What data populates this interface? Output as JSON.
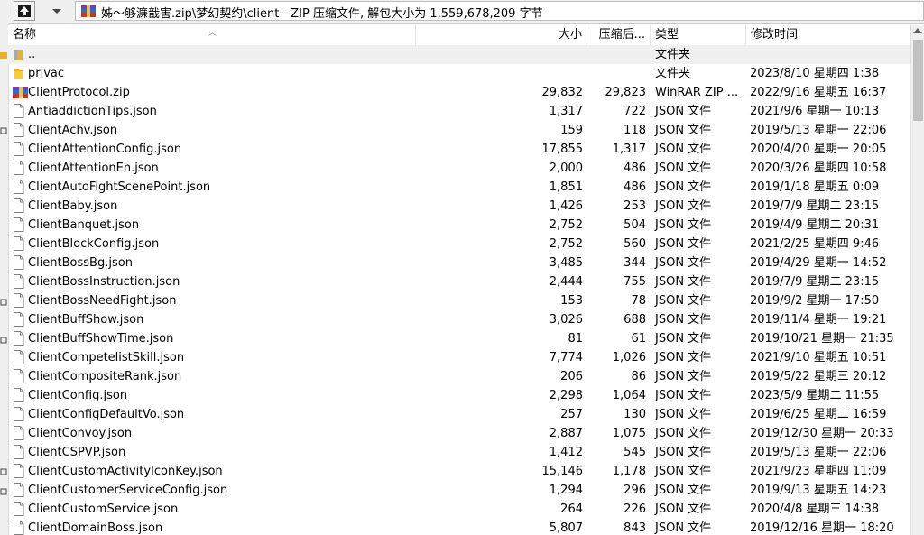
{
  "path_bar": {
    "path": "姊〜够濂戠害.zip\\梦幻契约\\client - ZIP 压缩文件, 解包大小为 1,559,678,209 字节"
  },
  "columns": {
    "name": "名称",
    "size": "大小",
    "packed": "压缩后...",
    "type": "类型",
    "modified": "修改时间"
  },
  "rows": [
    {
      "icon": "parent-folder-icon",
      "name": "..",
      "size": "",
      "packed": "",
      "type": "文件夹",
      "modified": ""
    },
    {
      "icon": "folder-icon",
      "name": "privac",
      "size": "",
      "packed": "",
      "type": "文件夹",
      "modified": "2023/8/10 星期四 1:38"
    },
    {
      "icon": "zip-archive-icon",
      "name": "ClientProtocol.zip",
      "size": "29,832",
      "packed": "29,823",
      "type": "WinRAR ZIP ...",
      "modified": "2022/9/16 星期五 16:37"
    },
    {
      "icon": "file-icon",
      "name": "AntiaddictionTips.json",
      "size": "1,317",
      "packed": "722",
      "type": "JSON 文件",
      "modified": "2021/9/6 星期一 10:13"
    },
    {
      "icon": "file-icon",
      "name": "ClientAchv.json",
      "size": "159",
      "packed": "118",
      "type": "JSON 文件",
      "modified": "2019/5/13 星期一 22:06"
    },
    {
      "icon": "file-icon",
      "name": "ClientAttentionConfig.json",
      "size": "17,855",
      "packed": "1,317",
      "type": "JSON 文件",
      "modified": "2020/4/20 星期一 20:05"
    },
    {
      "icon": "file-icon",
      "name": "ClientAttentionEn.json",
      "size": "2,000",
      "packed": "486",
      "type": "JSON 文件",
      "modified": "2020/3/26 星期四 10:58"
    },
    {
      "icon": "file-icon",
      "name": "ClientAutoFightScenePoint.json",
      "size": "1,851",
      "packed": "486",
      "type": "JSON 文件",
      "modified": "2019/1/18 星期五 0:09"
    },
    {
      "icon": "file-icon",
      "name": "ClientBaby.json",
      "size": "1,426",
      "packed": "253",
      "type": "JSON 文件",
      "modified": "2019/7/9 星期二 23:15"
    },
    {
      "icon": "file-icon",
      "name": "ClientBanquet.json",
      "size": "2,752",
      "packed": "504",
      "type": "JSON 文件",
      "modified": "2019/4/9 星期二 20:31"
    },
    {
      "icon": "file-icon",
      "name": "ClientBlockConfig.json",
      "size": "2,752",
      "packed": "560",
      "type": "JSON 文件",
      "modified": "2021/2/25 星期四 9:46"
    },
    {
      "icon": "file-icon",
      "name": "ClientBossBg.json",
      "size": "3,485",
      "packed": "344",
      "type": "JSON 文件",
      "modified": "2019/4/29 星期一 14:52"
    },
    {
      "icon": "file-icon",
      "name": "ClientBossInstruction.json",
      "size": "2,444",
      "packed": "755",
      "type": "JSON 文件",
      "modified": "2019/7/9 星期二 23:15"
    },
    {
      "icon": "file-icon",
      "name": "ClientBossNeedFight.json",
      "size": "153",
      "packed": "78",
      "type": "JSON 文件",
      "modified": "2019/9/2 星期一 17:50"
    },
    {
      "icon": "file-icon",
      "name": "ClientBuffShow.json",
      "size": "3,026",
      "packed": "688",
      "type": "JSON 文件",
      "modified": "2019/11/4 星期一 19:21"
    },
    {
      "icon": "file-icon",
      "name": "ClientBuffShowTime.json",
      "size": "81",
      "packed": "61",
      "type": "JSON 文件",
      "modified": "2019/10/21 星期一 21:35"
    },
    {
      "icon": "file-icon",
      "name": "ClientCompetelistSkill.json",
      "size": "7,774",
      "packed": "1,026",
      "type": "JSON 文件",
      "modified": "2021/9/10 星期五 10:51"
    },
    {
      "icon": "file-icon",
      "name": "ClientCompositeRank.json",
      "size": "206",
      "packed": "86",
      "type": "JSON 文件",
      "modified": "2019/5/22 星期三 20:12"
    },
    {
      "icon": "file-icon",
      "name": "ClientConfig.json",
      "size": "2,298",
      "packed": "1,064",
      "type": "JSON 文件",
      "modified": "2023/5/9 星期二 11:55"
    },
    {
      "icon": "file-icon",
      "name": "ClientConfigDefaultVo.json",
      "size": "257",
      "packed": "130",
      "type": "JSON 文件",
      "modified": "2019/6/25 星期二 16:59"
    },
    {
      "icon": "file-icon",
      "name": "ClientConvoy.json",
      "size": "2,887",
      "packed": "1,075",
      "type": "JSON 文件",
      "modified": "2019/12/30 星期一 20:33"
    },
    {
      "icon": "file-icon",
      "name": "ClientCSPVP.json",
      "size": "1,412",
      "packed": "545",
      "type": "JSON 文件",
      "modified": "2019/5/13 星期一 22:06"
    },
    {
      "icon": "file-icon",
      "name": "ClientCustomActivityIconKey.json",
      "size": "15,146",
      "packed": "1,178",
      "type": "JSON 文件",
      "modified": "2021/9/23 星期四 11:09"
    },
    {
      "icon": "file-icon",
      "name": "ClientCustomerServiceConfig.json",
      "size": "1,294",
      "packed": "296",
      "type": "JSON 文件",
      "modified": "2019/9/13 星期五 14:23"
    },
    {
      "icon": "file-icon",
      "name": "ClientCustomService.json",
      "size": "264",
      "packed": "226",
      "type": "JSON 文件",
      "modified": "2020/4/8 星期三 14:38"
    },
    {
      "icon": "file-icon",
      "name": "ClientDomainBoss.json",
      "size": "5,807",
      "packed": "843",
      "type": "JSON 文件",
      "modified": "2019/12/16 星期一 18:20"
    }
  ],
  "colors": {
    "folder": "#e8b030",
    "selected_row": "#f0f0f0",
    "scroll_thumb": "#c1c1c1"
  }
}
